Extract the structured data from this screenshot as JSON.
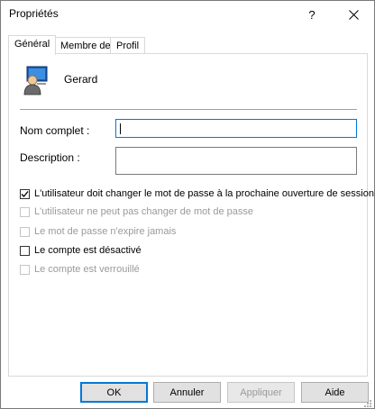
{
  "window": {
    "title": "Propriétés",
    "help_label": "?",
    "close_label": "✕"
  },
  "tabs": [
    {
      "label": "Général",
      "active": true
    },
    {
      "label": "Membre de",
      "active": false
    },
    {
      "label": "Profil",
      "active": false
    }
  ],
  "user": {
    "name": "Gerard",
    "icon": "user-icon"
  },
  "fields": {
    "full_name_label": "Nom complet :",
    "full_name_value": "",
    "description_label": "Description :",
    "description_value": ""
  },
  "checkboxes": [
    {
      "label": "L'utilisateur doit changer le mot de passe à la prochaine ouverture de session",
      "checked": true,
      "enabled": true
    },
    {
      "label": "L'utilisateur ne peut pas changer de mot de passe",
      "checked": false,
      "enabled": false
    },
    {
      "label": "Le mot de passe n'expire jamais",
      "checked": false,
      "enabled": false
    },
    {
      "label": "Le compte est désactivé",
      "checked": false,
      "enabled": true
    },
    {
      "label": "Le compte est verrouillé",
      "checked": false,
      "enabled": false
    }
  ],
  "buttons": {
    "ok": "OK",
    "cancel": "Annuler",
    "apply": "Appliquer",
    "help": "Aide"
  },
  "colors": {
    "accent": "#0078d7",
    "disabled_text": "#9a9a9a"
  }
}
